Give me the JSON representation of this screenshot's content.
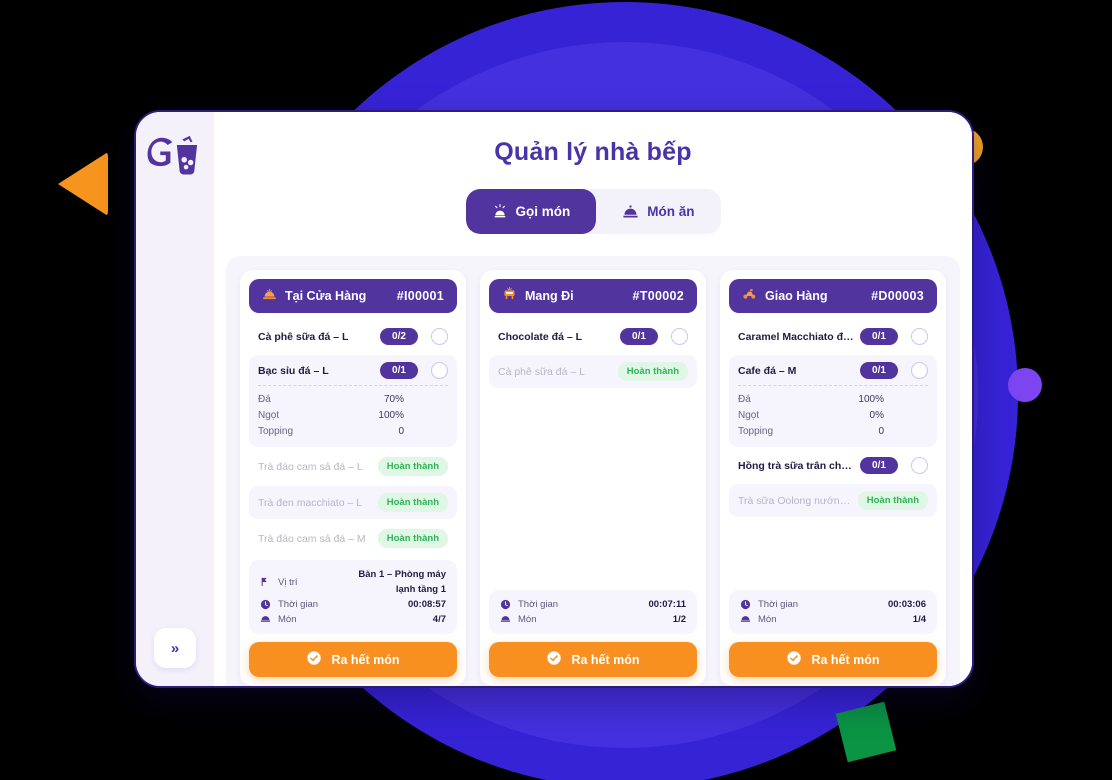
{
  "page": {
    "title": "Quản lý nhà bếp",
    "collapse_label": "»"
  },
  "logo": {
    "name": "go-bubble-tea-logo"
  },
  "tabs": [
    {
      "label": "Gọi món",
      "icon": "alarm-bell-icon",
      "active": true
    },
    {
      "label": "Món ăn",
      "icon": "food-dome-icon",
      "active": false
    }
  ],
  "orders": [
    {
      "type_label": "Tại Cửa Hàng",
      "code": "#I00001",
      "icon": "dine-in-icon",
      "items": [
        {
          "name": "Cà phê sữa đá – L",
          "qty": "0/2",
          "status": "pending",
          "shaded": false,
          "options": []
        },
        {
          "name": "Bạc sỉu đá – L",
          "qty": "0/1",
          "status": "pending",
          "shaded": true,
          "options": [
            {
              "label": "Đá",
              "value": "70%"
            },
            {
              "label": "Ngọt",
              "value": "100%"
            },
            {
              "label": "Topping",
              "value": "0"
            }
          ]
        },
        {
          "name": "Trà đào cam sả đá – L",
          "qty": "",
          "status": "done",
          "done_label": "Hoàn thành",
          "shaded": false,
          "options": []
        },
        {
          "name": "Trà đen macchiato – L",
          "qty": "",
          "status": "done",
          "done_label": "Hoàn thành",
          "shaded": true,
          "options": []
        },
        {
          "name": "Trà đào cam sả đá – M",
          "qty": "",
          "status": "done",
          "done_label": "Hoàn thành",
          "shaded": false,
          "options": []
        }
      ],
      "footer": [
        {
          "icon": "location-icon",
          "label": "Vị trí",
          "value": "Bàn 1 – Phòng máy lạnh tầng 1"
        },
        {
          "icon": "clock-icon",
          "label": "Thời gian",
          "value": "00:08:57"
        },
        {
          "icon": "dish-icon",
          "label": "Món",
          "value": "4/7"
        }
      ],
      "cta_label": "Ra hết món"
    },
    {
      "type_label": "Mang Đi",
      "code": "#T00002",
      "icon": "takeaway-icon",
      "items": [
        {
          "name": "Chocolate đá – L",
          "qty": "0/1",
          "status": "pending",
          "shaded": false,
          "options": []
        },
        {
          "name": "Cà phê sữa đá – L",
          "qty": "",
          "status": "done",
          "done_label": "Hoàn thành",
          "shaded": true,
          "options": []
        }
      ],
      "footer": [
        {
          "icon": "clock-icon",
          "label": "Thời gian",
          "value": "00:07:11"
        },
        {
          "icon": "dish-icon",
          "label": "Món",
          "value": "1/2"
        }
      ],
      "cta_label": "Ra hết món"
    },
    {
      "type_label": "Giao Hàng",
      "code": "#D00003",
      "icon": "delivery-icon",
      "items": [
        {
          "name": "Caramel Macchiato đá – L",
          "qty": "0/1",
          "status": "pending",
          "shaded": false,
          "options": []
        },
        {
          "name": "Cafe đá – M",
          "qty": "0/1",
          "status": "pending",
          "shaded": true,
          "options": [
            {
              "label": "Đá",
              "value": "100%"
            },
            {
              "label": "Ngọt",
              "value": "0%"
            },
            {
              "label": "Topping",
              "value": "0"
            }
          ]
        },
        {
          "name": "Hồng trà sữa trân châu – M",
          "qty": "0/1",
          "status": "pending",
          "shaded": false,
          "options": []
        },
        {
          "name": "Trà sữa Oolong nướng – M",
          "qty": "",
          "status": "done",
          "done_label": "Hoàn thành",
          "shaded": true,
          "options": []
        }
      ],
      "footer": [
        {
          "icon": "clock-icon",
          "label": "Thời gian",
          "value": "00:03:06"
        },
        {
          "icon": "dish-icon",
          "label": "Món",
          "value": "1/4"
        }
      ],
      "cta_label": "Ra hết món"
    }
  ],
  "colors": {
    "brand_purple": "#51349E",
    "accent_orange": "#F79021",
    "done_green": "#2FB457",
    "bg_blue": "#3723D6"
  }
}
